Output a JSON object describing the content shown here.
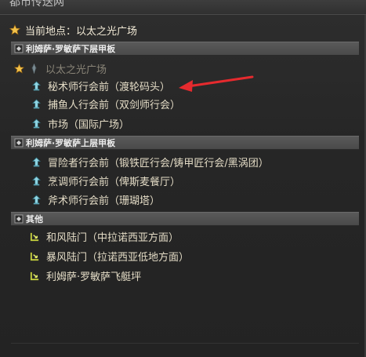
{
  "window": {
    "title": "都市传送网"
  },
  "current_location": {
    "text": "当前地点：以太之光广场"
  },
  "sections": [
    {
      "header": "利姆萨·罗敏萨下层甲板",
      "items": [
        {
          "label": "以太之光广场",
          "icon": "aetheryte-crystal-icon",
          "current": true
        },
        {
          "label": "秘术师行会前（渡轮码头）",
          "icon": "aethernet-shard-icon"
        },
        {
          "label": "捕鱼人行会前（双剑师行会）",
          "icon": "aethernet-shard-icon"
        },
        {
          "label": "市场（国际广场）",
          "icon": "aethernet-shard-icon"
        }
      ]
    },
    {
      "header": "利姆萨·罗敏萨上层甲板",
      "items": [
        {
          "label": "冒险者行会前（锻铁匠行会/铸甲匠行会/黑涡团）",
          "icon": "aethernet-shard-icon"
        },
        {
          "label": "烹调师行会前（俾斯麦餐厅）",
          "icon": "aethernet-shard-icon"
        },
        {
          "label": "斧术师行会前（珊瑚塔）",
          "icon": "aethernet-shard-icon"
        }
      ]
    },
    {
      "header": "其他",
      "items": [
        {
          "label": "和风陆门（中拉诺西亚方面）",
          "icon": "gate-exit-icon"
        },
        {
          "label": "暴风陆门（拉诺西亚低地方面）",
          "icon": "gate-exit-icon"
        },
        {
          "label": "利姆萨·罗敏萨飞艇坪",
          "icon": "gate-exit-icon"
        }
      ]
    }
  ],
  "colors": {
    "accent_star": "#f0c040",
    "arrow": "#e8262a",
    "shard": "#7ec8d8",
    "gate": "#c8d040"
  }
}
